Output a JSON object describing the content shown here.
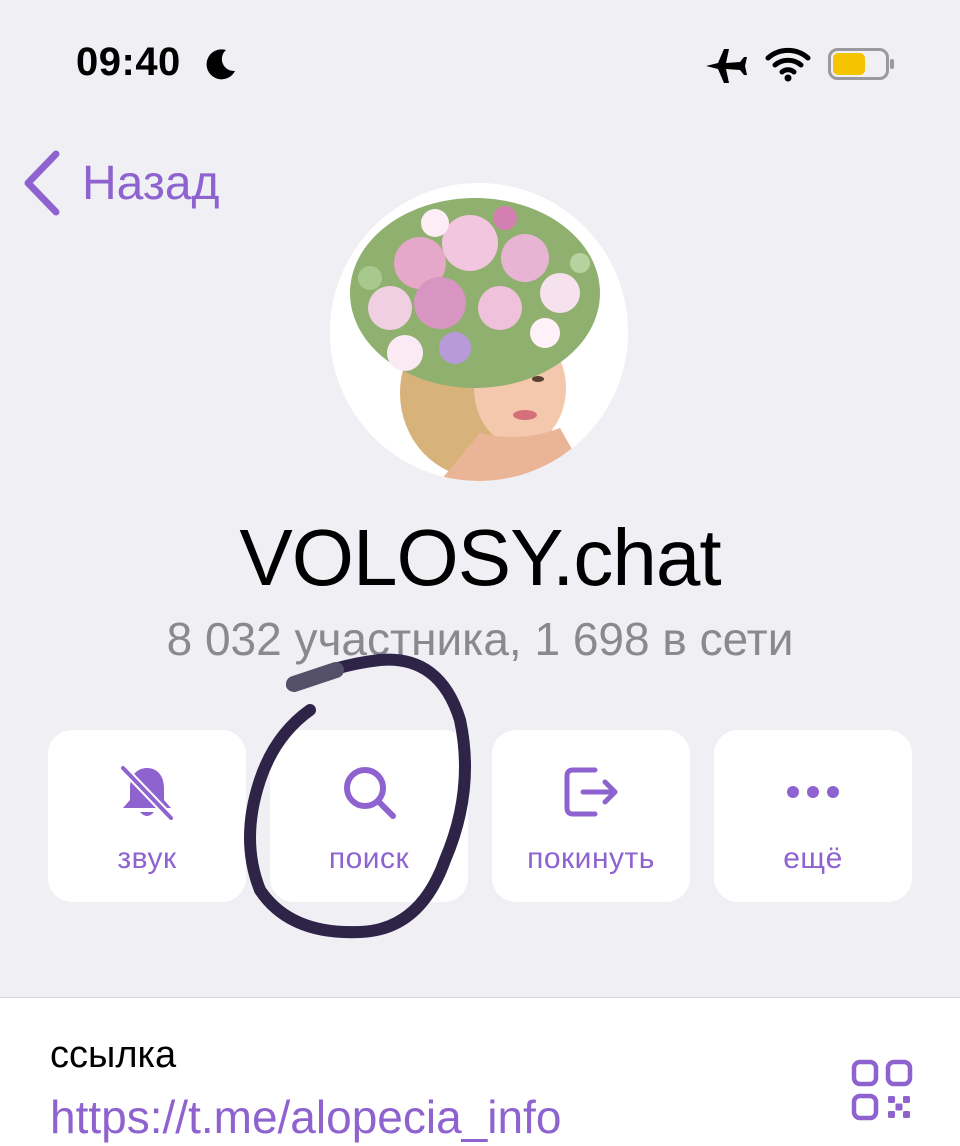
{
  "status_bar": {
    "time": "09:40",
    "icons": [
      "moon-icon",
      "airplane-icon",
      "wifi-icon",
      "battery-icon"
    ],
    "battery_color": "#f5c400"
  },
  "nav": {
    "back_label": "Назад"
  },
  "profile": {
    "title": "VOLOSY.chat",
    "subtitle": "8 032 участника, 1 698 в сети"
  },
  "actions": [
    {
      "label": "звук",
      "icon": "bell-slash-icon"
    },
    {
      "label": "поиск",
      "icon": "search-icon"
    },
    {
      "label": "покинуть",
      "icon": "leave-icon"
    },
    {
      "label": "ещё",
      "icon": "more-icon"
    }
  ],
  "info": {
    "link_label": "ссылка",
    "link_value": "https://t.me/alopecia_info",
    "qr_icon": "qr-code-icon"
  },
  "colors": {
    "accent": "#8e63cf",
    "background": "#efeff4",
    "annotation": "#2e2448"
  }
}
